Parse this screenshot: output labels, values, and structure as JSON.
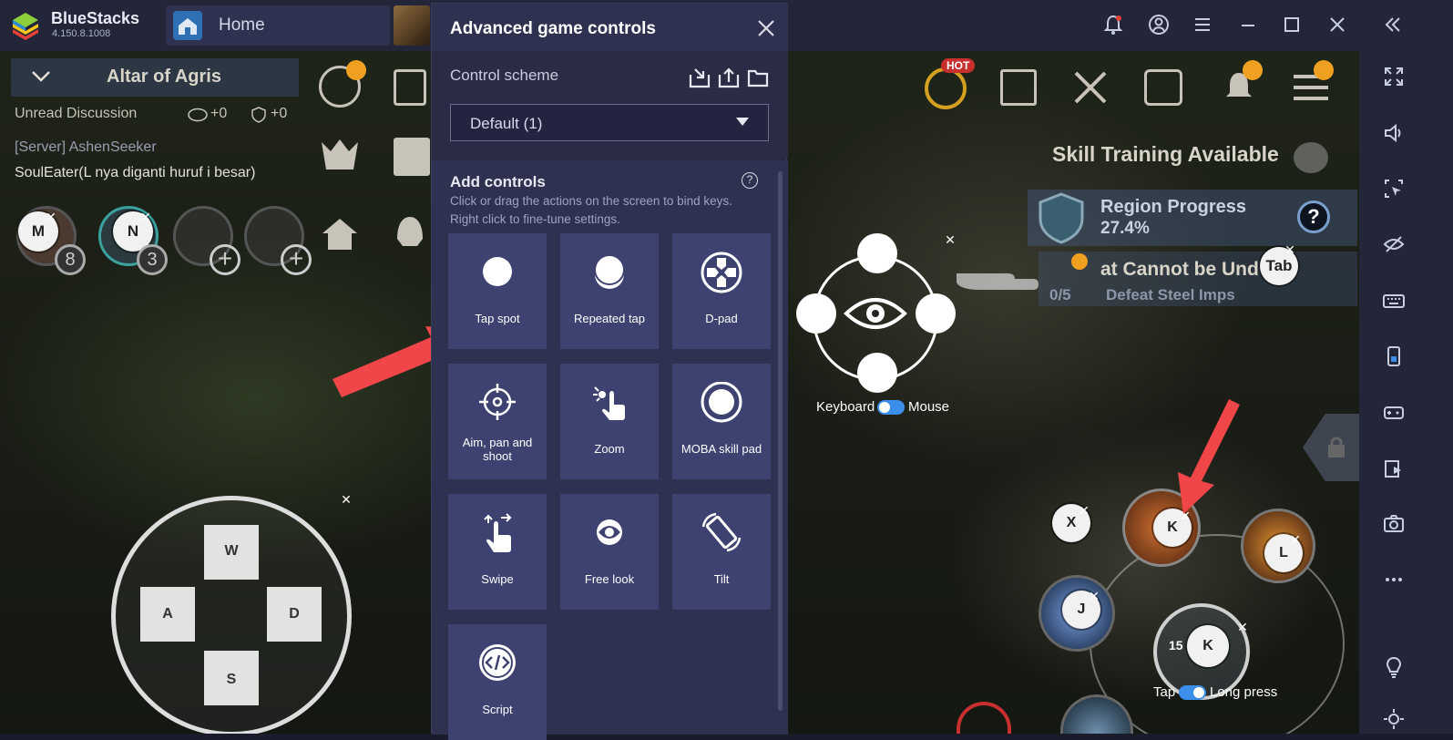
{
  "app": {
    "name": "BlueStacks",
    "version": "4.150.8.1008"
  },
  "tabs": {
    "home_label": "Home"
  },
  "game": {
    "quest_title": "Altar of Agris",
    "unread": "Unread Discussion",
    "chat_count_1": "+0",
    "chat_count_2": "+0",
    "server_line": "[Server] AshenSeeker",
    "chat_line": "SoulEater(L nya diganti huruf i besar)",
    "hot_badge": "HOT",
    "skill_training": "Skill Training Available",
    "region_title": "Region Progress",
    "region_value": "27.4%",
    "quest2_title": "at Cannot be Und",
    "quest2_progress": "0/5",
    "quest2_sub": "Defeat Steel Imps",
    "skill_count_1": "8",
    "skill_count_2": "3",
    "cooldown": "15",
    "keys": {
      "m": "M",
      "n": "N",
      "w": "W",
      "a": "A",
      "s": "S",
      "d": "D",
      "tab": "Tab",
      "x": "X",
      "k": "K",
      "l": "L",
      "j": "J",
      "k2": "K"
    },
    "toggle1_left": "Keyboard",
    "toggle1_right": "Mouse",
    "toggle2_left": "Tap",
    "toggle2_right": "Long press"
  },
  "dialog": {
    "title": "Advanced game controls",
    "scheme_label": "Control scheme",
    "scheme_value": "Default (1)",
    "add_controls_title": "Add controls",
    "hint_line1": "Click or drag the actions on the screen to bind keys.",
    "hint_line2": "Right click to fine-tune settings.",
    "controls": [
      {
        "label": "Tap spot",
        "icon": "tap-spot-icon"
      },
      {
        "label": "Repeated tap",
        "icon": "repeated-tap-icon"
      },
      {
        "label": "D-pad",
        "icon": "dpad-icon"
      },
      {
        "label": "Aim, pan and shoot",
        "icon": "crosshair-icon"
      },
      {
        "label": "Zoom",
        "icon": "zoom-gesture-icon"
      },
      {
        "label": "MOBA skill pad",
        "icon": "moba-skill-pad-icon"
      },
      {
        "label": "Swipe",
        "icon": "swipe-gesture-icon"
      },
      {
        "label": "Free look",
        "icon": "free-look-icon"
      },
      {
        "label": "Tilt",
        "icon": "tilt-icon"
      },
      {
        "label": "Script",
        "icon": "script-icon"
      }
    ]
  },
  "colors": {
    "accent_arrow": "#f0464a",
    "dialog_bg": "#2a2c45",
    "tile_bg": "#3e4270",
    "toggle_blue": "#3b8eea"
  }
}
